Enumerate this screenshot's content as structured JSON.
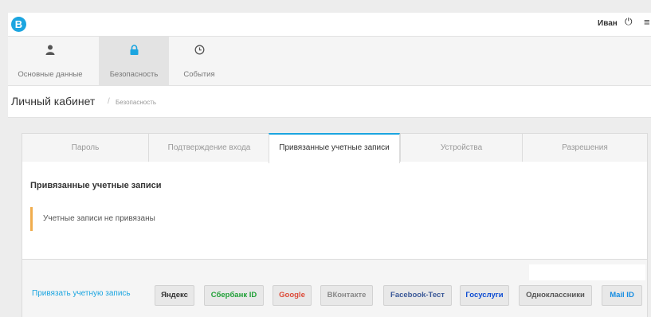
{
  "header": {
    "logo_letter": "B",
    "user_name": "Иван",
    "power_glyph": "⏻",
    "menu_glyph": "≡"
  },
  "nav": {
    "items": [
      {
        "label": "Основные данные",
        "icon": "user-icon",
        "glyph": "👤"
      },
      {
        "label": "Безопасность",
        "icon": "lock-icon",
        "glyph": "🔒"
      },
      {
        "label": "События",
        "icon": "clock-icon",
        "glyph": "⏲"
      }
    ],
    "active_index": 1
  },
  "page": {
    "title": "Личный кабинет",
    "separator": "/",
    "breadcrumb": "Безопасность"
  },
  "tabs": [
    {
      "label": "Пароль"
    },
    {
      "label": "Подтверждение входа"
    },
    {
      "label": "Привязанные учетные записи"
    },
    {
      "label": "Устройства"
    },
    {
      "label": "Разрешения"
    }
  ],
  "active_tab": 2,
  "panel": {
    "title": "Привязанные учетные записи",
    "empty_message": "Учетные записи не привязаны"
  },
  "actions": {
    "bind_label": "Привязать учетную запись",
    "providers": [
      {
        "label": "Яндекс",
        "color": "#333333"
      },
      {
        "label": "Сбербанк ID",
        "color": "#21a038"
      },
      {
        "label": "Google",
        "color": "#dd4b39"
      },
      {
        "label": "ВКонтакте",
        "color": "#888888"
      },
      {
        "label": "Facebook-Тест",
        "color": "#3b5998"
      },
      {
        "label": "Госуслуги",
        "color": "#0d4cd3"
      },
      {
        "label": "Одноклассники",
        "color": "#555555"
      },
      {
        "label": "Mail ID",
        "color": "#168de2"
      }
    ]
  },
  "colors": {
    "accent": "#1ba5e0",
    "alert_border": "#f0ad4e"
  }
}
